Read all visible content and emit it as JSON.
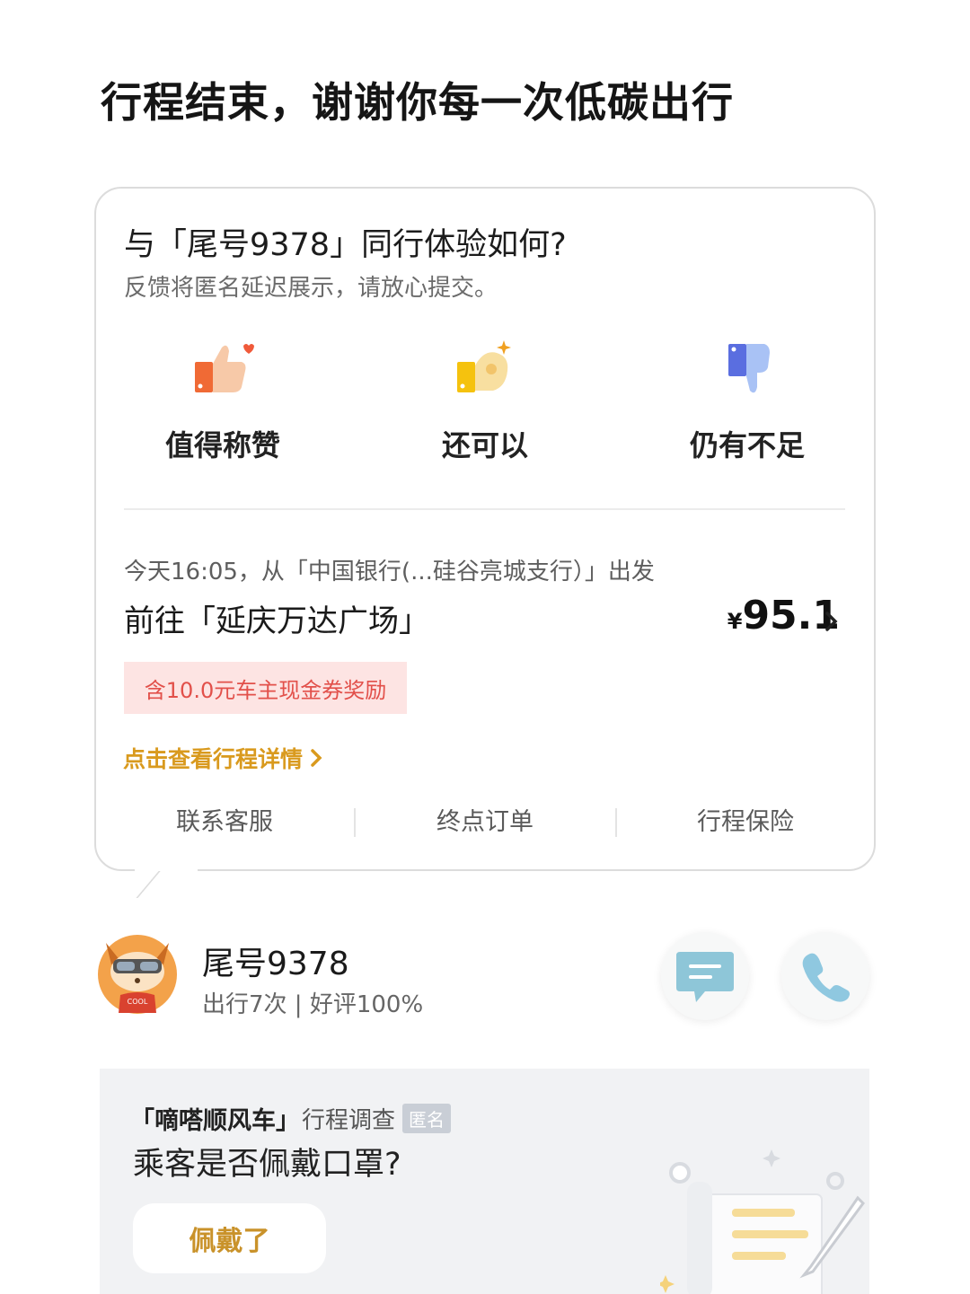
{
  "headline": "行程结束，谢谢你每一次低碳出行",
  "feedback": {
    "title": "与「尾号9378」同行体验如何?",
    "subtitle": "反馈将匿名延迟展示，请放心提交。",
    "options": [
      {
        "label": "值得称赞",
        "icon": "thumbs-up-heart-icon"
      },
      {
        "label": "还可以",
        "icon": "ok-hand-sparkle-icon"
      },
      {
        "label": "仍有不足",
        "icon": "thumbs-down-icon"
      }
    ]
  },
  "trip": {
    "meta": "今天16:05，从「中国银行(...硅谷亮城支行）」出发",
    "destination": "前往「延庆万达广场」",
    "currency": "¥",
    "price": "95.1",
    "coupon": "含10.0元车主现金券奖励",
    "detail_link": "点击查看行程详情"
  },
  "actions": [
    "联系客服",
    "终点订单",
    "行程保险"
  ],
  "driver": {
    "name": "尾号9378",
    "stats": "出行7次 | 好评100%",
    "avatar_badge": "COOL"
  },
  "survey": {
    "brand": "「嘀嗒顺风车」",
    "kind": "行程调查",
    "tag": "匿名",
    "question": "乘客是否佩戴口罩?",
    "answer_button": "佩戴了"
  },
  "colors": {
    "accent_gold": "#d99a1e",
    "coupon_bg": "#fde4e3",
    "coupon_text": "#e2504a"
  }
}
